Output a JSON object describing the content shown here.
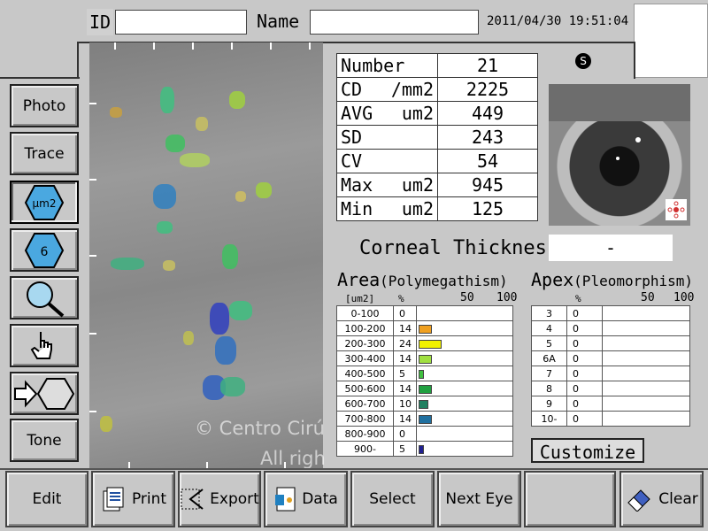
{
  "header": {
    "id_label": "ID",
    "id_value": "",
    "name_label": "Name",
    "name_value": "",
    "datetime": "2011/04/30 19:51:04"
  },
  "sidebar": [
    {
      "key": "photo",
      "label": "Photo"
    },
    {
      "key": "trace",
      "label": "Trace"
    },
    {
      "key": "um2",
      "label": "μm2"
    },
    {
      "key": "hex6",
      "label": "6"
    },
    {
      "key": "zoom",
      "label": ""
    },
    {
      "key": "hand",
      "label": ""
    },
    {
      "key": "arrow",
      "label": ""
    },
    {
      "key": "tone",
      "label": "Tone"
    }
  ],
  "stats": {
    "rows": [
      {
        "label": "Number",
        "unit": "",
        "value": "21"
      },
      {
        "label": "CD",
        "unit": "/mm2",
        "value": "2225"
      },
      {
        "label": "AVG",
        "unit": "um2",
        "value": "449"
      },
      {
        "label": "SD",
        "unit": "",
        "value": "243"
      },
      {
        "label": "CV",
        "unit": "",
        "value": "54"
      },
      {
        "label": "Max",
        "unit": "um2",
        "value": "945"
      },
      {
        "label": "Min",
        "unit": "um2",
        "value": "125"
      }
    ]
  },
  "eye_badge": "S",
  "corneal": {
    "label": "Corneal Thickness",
    "value": "-"
  },
  "area": {
    "title": "Area",
    "subtitle": "(Polymegathism)",
    "unit_header": "[um2]",
    "pct_header": "%",
    "scale_50": "50",
    "scale_100": "100",
    "rows": [
      {
        "range": "0-100",
        "pct": "0",
        "color": "#ffffff"
      },
      {
        "range": "100-200",
        "pct": "14",
        "color": "#f0a020"
      },
      {
        "range": "200-300",
        "pct": "24",
        "color": "#f0f000"
      },
      {
        "range": "300-400",
        "pct": "14",
        "color": "#a0e040"
      },
      {
        "range": "400-500",
        "pct": "5",
        "color": "#40c040"
      },
      {
        "range": "500-600",
        "pct": "14",
        "color": "#20a040"
      },
      {
        "range": "600-700",
        "pct": "10",
        "color": "#208060"
      },
      {
        "range": "700-800",
        "pct": "14",
        "color": "#2070a0"
      },
      {
        "range": "800-900",
        "pct": "0",
        "color": "#2040b0"
      },
      {
        "range": "900-",
        "pct": "5",
        "color": "#202090"
      }
    ]
  },
  "apex": {
    "title": "Apex",
    "subtitle": "(Pleomorphism)",
    "pct_header": "%",
    "scale_50": "50",
    "scale_100": "100",
    "rows": [
      {
        "n": "3",
        "pct": "0"
      },
      {
        "n": "4",
        "pct": "0"
      },
      {
        "n": "5",
        "pct": "0"
      },
      {
        "n": "6A",
        "pct": "0"
      },
      {
        "n": "7",
        "pct": "0"
      },
      {
        "n": "8",
        "pct": "0"
      },
      {
        "n": "9",
        "pct": "0"
      },
      {
        "n": "10-",
        "pct": "0"
      }
    ]
  },
  "customize_label": "Customize",
  "watermark": {
    "line1": "© Centro Cirú",
    "line2": "All righ"
  },
  "bottom": [
    {
      "key": "edit",
      "label": "Edit"
    },
    {
      "key": "print",
      "label": "Print"
    },
    {
      "key": "export",
      "label": "Export"
    },
    {
      "key": "data",
      "label": "Data"
    },
    {
      "key": "select",
      "label": "Select"
    },
    {
      "key": "next",
      "label": "Next Eye"
    },
    {
      "key": "blank",
      "label": ""
    },
    {
      "key": "clear",
      "label": "Clear"
    }
  ]
}
